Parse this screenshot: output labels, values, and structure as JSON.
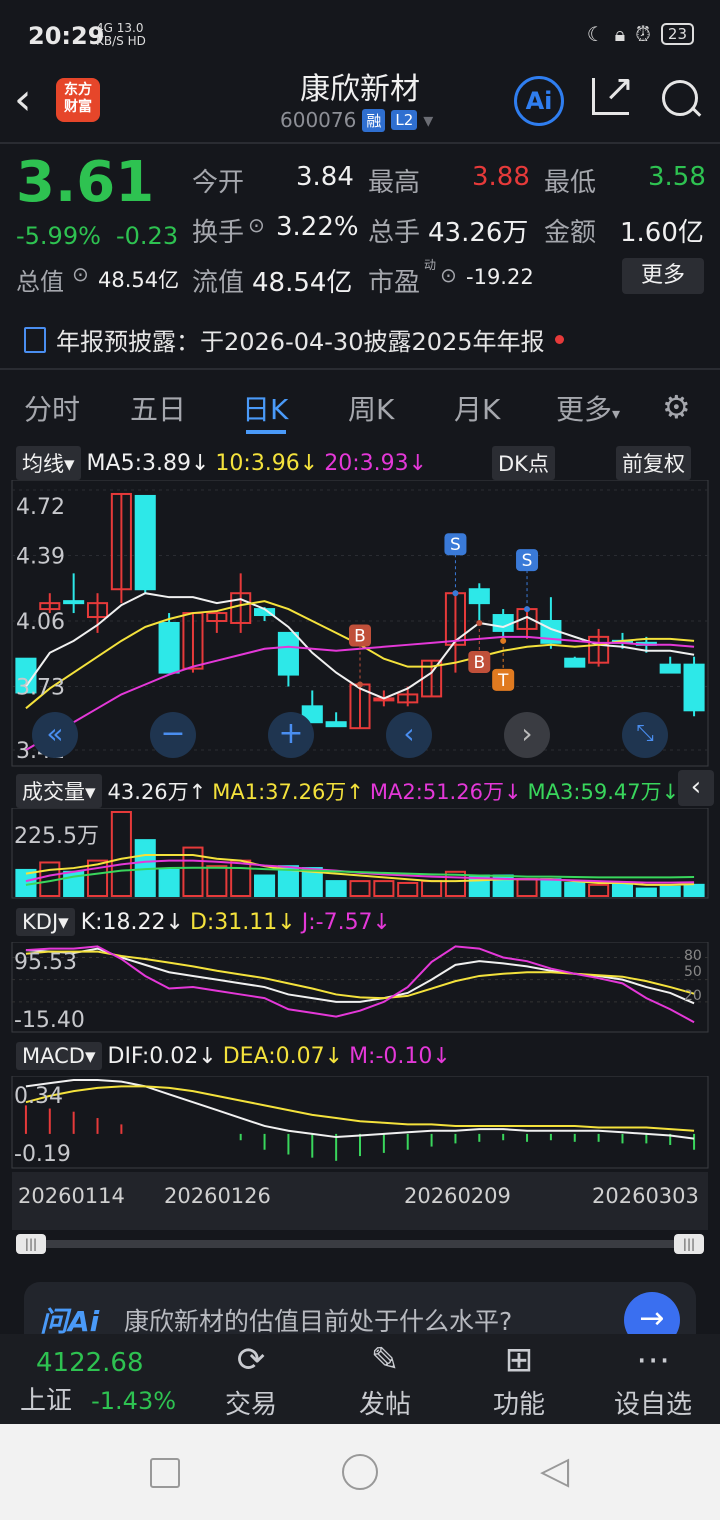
{
  "status": {
    "time": "20:29",
    "net_signal": "4G",
    "net_speed": "13.0",
    "net_unit": "KB/S",
    "hd": "HD",
    "battery": "23"
  },
  "header": {
    "logo_line1": "东方",
    "logo_line2": "财富",
    "title": "康欣新材",
    "code": "600076",
    "badge_rong": "融",
    "badge_l2": "L2",
    "ai": "Ai"
  },
  "quote": {
    "price": "3.61",
    "change_pct": "-5.99%",
    "change": "-0.23",
    "open_label": "今开",
    "open": "3.84",
    "high_label": "最高",
    "high": "3.88",
    "low_label": "最低",
    "low": "3.58",
    "turnover_label": "换手",
    "turnover": "3.22%",
    "volume_label": "总手",
    "volume": "43.26万",
    "amount_label": "金额",
    "amount": "1.60亿",
    "mktcap_label": "总值",
    "mktcap": "48.54亿",
    "float_label": "流值",
    "float": "48.54亿",
    "pe_label": "市盈",
    "pe_sup": "动",
    "pe": "-19.22",
    "more": "更多"
  },
  "notice": "年报预披露：于2026-04-30披露2025年年报",
  "tabs": [
    {
      "label": "分时"
    },
    {
      "label": "五日"
    },
    {
      "label": "日K"
    },
    {
      "label": "周K"
    },
    {
      "label": "月K"
    },
    {
      "label": "更多"
    }
  ],
  "kline_bar": {
    "selector": "均线",
    "ma5": "MA5:3.89↓",
    "ma10": "10:3.96↓",
    "ma20": "20:3.93↓",
    "dk": "DK点",
    "adjust": "前复权"
  },
  "kline_axis": [
    "4.72",
    "4.39",
    "4.06",
    "3.73",
    "3.41"
  ],
  "markers": {
    "s": "S",
    "b": "B",
    "t": "T"
  },
  "vol_bar": {
    "selector": "成交量",
    "vol": "43.26万↑",
    "ma1": "MA1:37.26万↑",
    "ma2": "MA2:51.26万↓",
    "ma3": "MA3:59.47万↓",
    "max": "225.5万"
  },
  "kdj_bar": {
    "selector": "KDJ",
    "k": "K:18.22↓",
    "d": "D:31.11↓",
    "j": "J:-7.57↓",
    "top": "95.53",
    "bottom": "-15.40",
    "lv80": "80",
    "lv50": "50",
    "lv20": "20"
  },
  "macd_bar": {
    "selector": "MACD",
    "dif": "DIF:0.02↓",
    "dea": "DEA:0.07↓",
    "m": "M:-0.10↓",
    "top": "0.34",
    "bottom": "-0.19"
  },
  "dates": [
    "20260114",
    "20260126",
    "20260209",
    "20260303"
  ],
  "ask": {
    "logo": "问Ai",
    "text": "康欣新材的估值目前处于什么水平?"
  },
  "bottom_nav": {
    "index_value": "4122.68",
    "index_name": "上证",
    "index_change": "-1.43%",
    "trade": "交易",
    "post": "发帖",
    "func": "功能",
    "watch": "设自选"
  },
  "chart_data": {
    "type": "candlestick",
    "ylim": [
      3.41,
      4.72
    ],
    "candles": [
      {
        "o": 3.87,
        "c": 3.7,
        "h": 3.87,
        "l": 3.7
      },
      {
        "o": 4.12,
        "c": 4.15,
        "h": 4.2,
        "l": 4.1
      },
      {
        "o": 4.16,
        "c": 4.15,
        "h": 4.3,
        "l": 4.1
      },
      {
        "o": 4.08,
        "c": 4.15,
        "h": 4.2,
        "l": 4.0
      },
      {
        "o": 4.22,
        "c": 4.7,
        "h": 4.7,
        "l": 4.15
      },
      {
        "o": 4.69,
        "c": 4.22,
        "h": 4.69,
        "l": 4.2
      },
      {
        "o": 4.05,
        "c": 3.8,
        "h": 4.1,
        "l": 3.8
      },
      {
        "o": 3.82,
        "c": 4.1,
        "h": 4.1,
        "l": 3.8
      },
      {
        "o": 4.06,
        "c": 4.1,
        "h": 4.1,
        "l": 4.0
      },
      {
        "o": 4.05,
        "c": 4.2,
        "h": 4.3,
        "l": 4.0
      },
      {
        "o": 4.12,
        "c": 4.09,
        "h": 4.13,
        "l": 4.06
      },
      {
        "o": 4.0,
        "c": 3.79,
        "h": 4.0,
        "l": 3.73
      },
      {
        "o": 3.63,
        "c": 3.55,
        "h": 3.71,
        "l": 3.55
      },
      {
        "o": 3.55,
        "c": 3.53,
        "h": 3.6,
        "l": 3.53
      },
      {
        "o": 3.52,
        "c": 3.74,
        "h": 3.74,
        "l": 3.52
      },
      {
        "o": 3.66,
        "c": 3.67,
        "h": 3.71,
        "l": 3.63
      },
      {
        "o": 3.65,
        "c": 3.69,
        "h": 3.73,
        "l": 3.63
      },
      {
        "o": 3.68,
        "c": 3.86,
        "h": 3.86,
        "l": 3.68
      },
      {
        "o": 3.94,
        "c": 4.2,
        "h": 4.2,
        "l": 3.8
      },
      {
        "o": 4.22,
        "c": 4.15,
        "h": 4.25,
        "l": 4.05
      },
      {
        "o": 4.09,
        "c": 4.01,
        "h": 4.12,
        "l": 3.96
      },
      {
        "o": 4.02,
        "c": 4.12,
        "h": 4.12,
        "l": 3.97
      },
      {
        "o": 4.06,
        "c": 3.95,
        "h": 4.18,
        "l": 3.92
      },
      {
        "o": 3.87,
        "c": 3.83,
        "h": 3.88,
        "l": 3.83
      },
      {
        "o": 3.85,
        "c": 3.98,
        "h": 4.02,
        "l": 3.83
      },
      {
        "o": 3.96,
        "c": 3.95,
        "h": 4.0,
        "l": 3.92
      },
      {
        "o": 3.95,
        "c": 3.94,
        "h": 3.98,
        "l": 3.9
      },
      {
        "o": 3.84,
        "c": 3.8,
        "h": 3.88,
        "l": 3.8
      },
      {
        "o": 3.84,
        "c": 3.61,
        "h": 3.88,
        "l": 3.58
      }
    ],
    "ma5": [
      3.73,
      3.9,
      3.96,
      4.04,
      4.14,
      4.2,
      4.18,
      4.18,
      4.15,
      4.17,
      4.12,
      4.03,
      3.9,
      3.8,
      3.72,
      3.67,
      3.72,
      3.8,
      3.96,
      4.05,
      4.03,
      4.08,
      4.02,
      3.98,
      3.94,
      3.93,
      3.91,
      3.91,
      3.89
    ],
    "ma10": [
      3.62,
      3.72,
      3.8,
      3.88,
      3.96,
      4.03,
      4.07,
      4.1,
      4.11,
      4.14,
      4.16,
      4.12,
      4.06,
      4.0,
      3.94,
      3.87,
      3.83,
      3.83,
      3.85,
      3.88,
      3.91,
      3.93,
      3.94,
      3.93,
      3.94,
      3.96,
      3.97,
      3.97,
      3.96
    ],
    "ma20": [
      3.41,
      3.48,
      3.55,
      3.62,
      3.69,
      3.74,
      3.79,
      3.83,
      3.86,
      3.89,
      3.92,
      3.93,
      3.92,
      3.91,
      3.92,
      3.93,
      3.94,
      3.95,
      3.96,
      3.97,
      3.98,
      3.98,
      3.97,
      3.96,
      3.95,
      3.95,
      3.94,
      3.94,
      3.93
    ],
    "volume": [
      70,
      90,
      65,
      95,
      225.5,
      150,
      70,
      130,
      80,
      95,
      55,
      80,
      75,
      40,
      40,
      40,
      35,
      40,
      65,
      55,
      55,
      45,
      45,
      35,
      30,
      35,
      20,
      25,
      30
    ],
    "vol_ma": [
      [
        60,
        70,
        75,
        85,
        100,
        110,
        110,
        110,
        100,
        95,
        80,
        70,
        65,
        60,
        55,
        50,
        45,
        40,
        40,
        42,
        45,
        45,
        45,
        40,
        35,
        35,
        30,
        30,
        32
      ],
      [
        40,
        55,
        65,
        75,
        85,
        92,
        95,
        95,
        92,
        88,
        82,
        78,
        72,
        68,
        62,
        58,
        55,
        52,
        50,
        48,
        46,
        45,
        44,
        42,
        40,
        38,
        36,
        36,
        37
      ],
      [
        30,
        40,
        52,
        60,
        68,
        72,
        75,
        76,
        76,
        75,
        72,
        70,
        68,
        66,
        64,
        62,
        60,
        58,
        57,
        55,
        54,
        52,
        52,
        51,
        50,
        50,
        50,
        50,
        51
      ]
    ],
    "kdj": {
      "k": [
        90,
        88,
        86,
        92,
        80,
        70,
        60,
        55,
        50,
        45,
        40,
        30,
        25,
        20,
        20,
        25,
        32,
        50,
        70,
        75,
        72,
        68,
        62,
        58,
        55,
        50,
        40,
        32,
        18
      ],
      "d": [
        85,
        88,
        88,
        88,
        82,
        78,
        73,
        68,
        62,
        57,
        52,
        45,
        38,
        30,
        26,
        25,
        28,
        38,
        48,
        55,
        58,
        60,
        60,
        58,
        56,
        54,
        48,
        40,
        31
      ],
      "j": [
        90,
        92,
        92,
        95,
        78,
        55,
        38,
        40,
        35,
        30,
        25,
        10,
        5,
        0,
        8,
        20,
        40,
        74,
        95,
        92,
        80,
        75,
        65,
        58,
        52,
        45,
        25,
        10,
        -7.57
      ]
    },
    "macd": {
      "dif": [
        0.3,
        0.32,
        0.34,
        0.34,
        0.33,
        0.3,
        0.25,
        0.2,
        0.15,
        0.1,
        0.05,
        0.02,
        0.0,
        -0.02,
        -0.01,
        0.0,
        0.01,
        0.02,
        0.02,
        0.03,
        0.03,
        0.02,
        0.02,
        0.02,
        0.02,
        0.01,
        0.0,
        -0.01,
        -0.03
      ],
      "dea": [
        0.2,
        0.24,
        0.27,
        0.29,
        0.3,
        0.3,
        0.29,
        0.27,
        0.24,
        0.21,
        0.18,
        0.15,
        0.12,
        0.1,
        0.08,
        0.07,
        0.06,
        0.06,
        0.05,
        0.05,
        0.05,
        0.05,
        0.05,
        0.05,
        0.04,
        0.04,
        0.04,
        0.03,
        0.02
      ],
      "m": [
        0.18,
        0.16,
        0.14,
        0.1,
        0.06,
        0,
        0,
        0,
        0,
        -0.04,
        -0.1,
        -0.13,
        -0.15,
        -0.17,
        -0.14,
        -0.12,
        -0.1,
        -0.08,
        -0.06,
        -0.05,
        -0.04,
        -0.05,
        -0.04,
        -0.05,
        -0.05,
        -0.06,
        -0.06,
        -0.07,
        -0.1
      ]
    }
  }
}
